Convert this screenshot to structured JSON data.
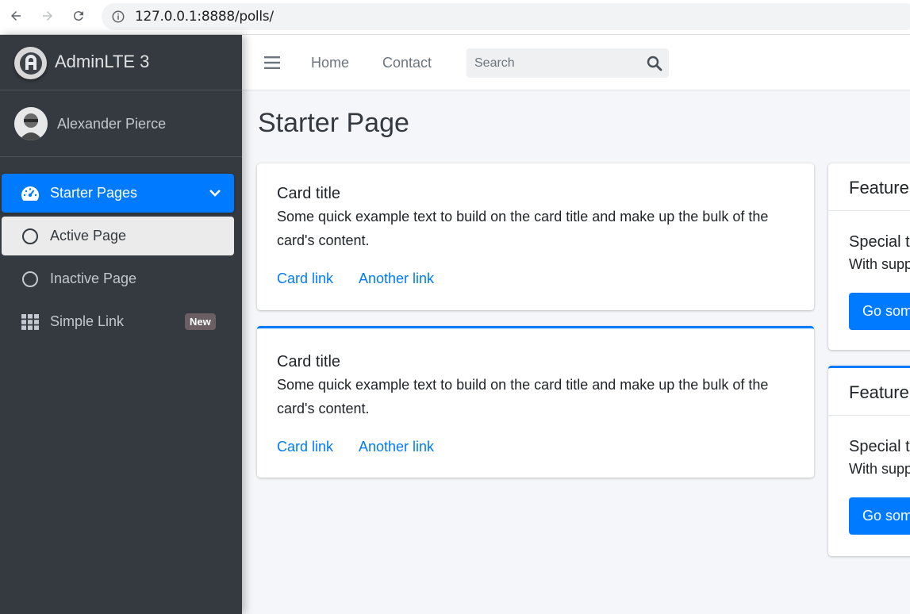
{
  "browser": {
    "url": "127.0.0.1:8888/polls/"
  },
  "brand": {
    "name": "AdminLTE 3"
  },
  "user": {
    "name": "Alexander Pierce"
  },
  "sidebar": {
    "items": [
      {
        "label": "Starter Pages",
        "icon": "dashboard-gauge-icon",
        "state": "open"
      },
      {
        "label": "Active Page",
        "icon": "circle-outline-icon",
        "state": "active"
      },
      {
        "label": "Inactive Page",
        "icon": "circle-outline-icon",
        "state": "inactive"
      },
      {
        "label": "Simple Link",
        "icon": "grid-icon",
        "badge": "New"
      }
    ]
  },
  "topnav": {
    "links": [
      "Home",
      "Contact"
    ],
    "search_placeholder": "Search"
  },
  "page": {
    "title": "Starter Page"
  },
  "cards": [
    {
      "title": "Card title",
      "text": "Some quick example text to build on the card title and make up the bulk of the card's content.",
      "links": [
        "Card link",
        "Another link"
      ]
    },
    {
      "title": "Card title",
      "text": "Some quick example text to build on the card title and make up the bulk of the card's content.",
      "links": [
        "Card link",
        "Another link"
      ]
    }
  ],
  "featured_cards": [
    {
      "header": "Feature",
      "title": "Special t",
      "text": "With supp",
      "button": "Go som"
    },
    {
      "header": "Feature",
      "title": "Special t",
      "text": "With supp",
      "button": "Go som"
    }
  ],
  "colors": {
    "primary": "#007bff",
    "sidebar_bg": "#343a40",
    "badge": "#6b5f64"
  }
}
